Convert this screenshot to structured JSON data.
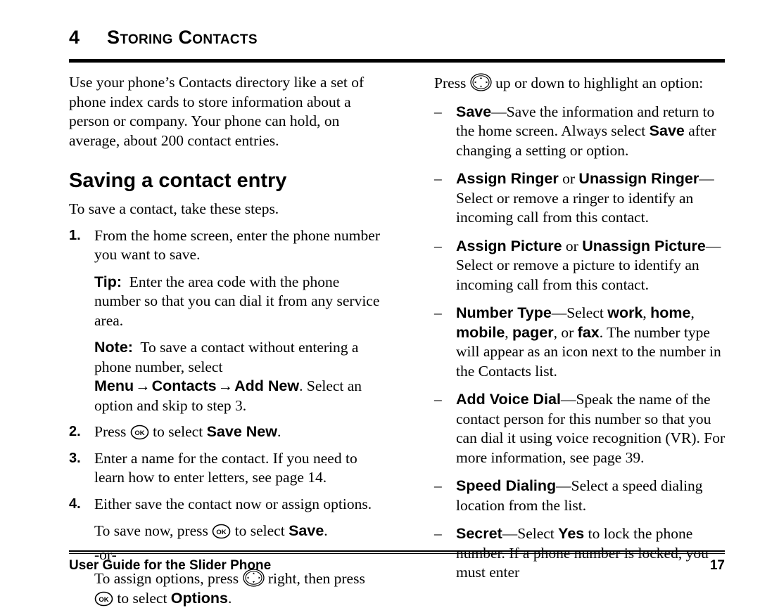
{
  "chapter": {
    "number": "4",
    "title": "Storing Contacts"
  },
  "icons": {
    "ok_key_label": "OK",
    "nav_key_name": "navigation-key-icon"
  },
  "left_column": {
    "intro": "Use your phone’s Contacts directory like a set of phone index cards to store information about a person or company. Your phone can hold, on average, about 200 contact entries.",
    "section_heading": "Saving a contact entry",
    "lead": "To save a contact, take these steps.",
    "steps": [
      {
        "number": "1.",
        "text": "From the home screen, enter the phone number you want to save.",
        "notes": [
          {
            "label": "Tip:",
            "text": "Enter the area code with the phone number so that you can dial it from any service area."
          },
          {
            "label": "Note:",
            "text_before": "To save a contact without entering a phone number, select ",
            "menu_1": "Menu",
            "arrow": "→",
            "menu_2": "Contacts",
            "menu_3": "Add New",
            "text_after": ". Select an option and skip to step 3."
          }
        ]
      },
      {
        "number": "2.",
        "text_before": "Press ",
        "text_mid": " to select ",
        "bold_term": "Save New",
        "text_after": "."
      },
      {
        "number": "3.",
        "text": "Enter a name for the contact. If you need to learn how to enter letters, see page 14."
      },
      {
        "number": "4.",
        "text": "Either save the contact now or assign options.",
        "save_now": {
          "text_before": "To save now, press ",
          "text_mid": " to select ",
          "bold_term": "Save",
          "text_after": "."
        },
        "or_label": "-or-",
        "assign_options": {
          "text_before": "To assign options, press ",
          "text_mid": " right, then press ",
          "text_after": " to select ",
          "bold_term": "Options",
          "text_end": "."
        }
      }
    ]
  },
  "right_column": {
    "intro": {
      "text_before": "Press ",
      "text_after": " up or down to highlight an option:"
    },
    "dash_mark": "–",
    "options": [
      {
        "term": "Save",
        "dash": "—",
        "desc_1": "Save the information and return to the home screen. Always select ",
        "bold_inline": "Save",
        "desc_2": " after changing a setting or option."
      },
      {
        "term": "Assign Ringer",
        "conjunction": " or ",
        "term_2": "Unassign Ringer",
        "dash": "—",
        "desc_1": "Select or remove a ringer to identify an incoming call from this contact."
      },
      {
        "term": "Assign Picture",
        "conjunction": " or ",
        "term_2": "Unassign Picture",
        "dash": "—",
        "desc_1": "Select or remove a picture to identify an incoming call from this contact."
      },
      {
        "term": "Number Type",
        "dash": "—",
        "desc_1": "Select ",
        "types": [
          "work",
          "home",
          "mobile",
          "pager",
          "fax"
        ],
        "desc_or": ", or ",
        "desc_2": ". The number type will appear as an icon next to the number in the Contacts list."
      },
      {
        "term": "Add Voice Dial",
        "dash": "—",
        "desc_1": "Speak the name of the contact person for this number so that you can dial it using voice recognition (VR). For more information, see page 39."
      },
      {
        "term": "Speed Dialing",
        "dash": "—",
        "desc_1": "Select a speed dialing location from the list."
      },
      {
        "term": "Secret",
        "dash": "—",
        "desc_1": "Select ",
        "bold_inline": "Yes",
        "desc_2": " to lock the phone number. If a phone number is locked, you must enter"
      }
    ]
  },
  "footer": {
    "left": "User Guide for the Slider Phone",
    "page_number": "17"
  }
}
